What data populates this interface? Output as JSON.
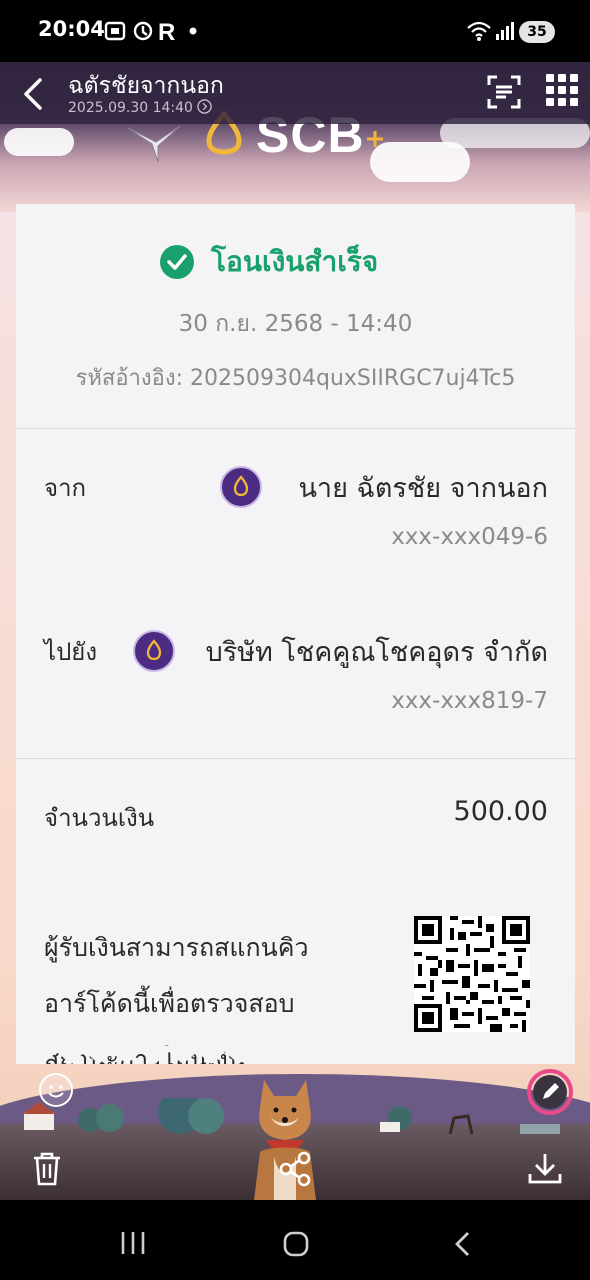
{
  "status_bar": {
    "time": "20:04",
    "battery": "35",
    "icons": [
      "screenshot-icon",
      "vpn-icon",
      "r-app-icon",
      "notification-dot-icon",
      "wifi-icon",
      "signal-icon"
    ]
  },
  "app_bar": {
    "title": "ฉตัรชัยจากนอก",
    "subtitle": "2025.09.30 14:40"
  },
  "brand": {
    "name": "SCB",
    "color": "#4c2b82",
    "logo_gold": "#f0b63a"
  },
  "slip": {
    "status_text": "โอนเงินสำเร็จ",
    "status_color": "#1aa06c",
    "date_time": "30 ก.ย. 2568 - 14:40",
    "ref_label": "รหัสอ้างอิง:",
    "ref_value": "202509304quxSIIRGC7uj4Tc5",
    "from_label": "จาก",
    "from_name": "นาย ฉัตรชัย จากนอก",
    "from_account": "xxx-xxx049-6",
    "to_label": "ไปยัง",
    "to_name": "บริษัท โชคคูณโชคอุดร จำกัด",
    "to_account": "xxx-xxx819-7",
    "amount_label": "จำนวนเงิน",
    "amount_value": "500.00",
    "qr_note_line1": "ผู้รับเงินสามารถสแกนคิว",
    "qr_note_line2": "อาร์โค้ดนี้เพื่อตรวจสอบ",
    "qr_note_line3": "สถานะการโอนเงิน"
  },
  "toolbar": {
    "actions": [
      "delete-icon",
      "share-icon",
      "download-icon"
    ]
  }
}
